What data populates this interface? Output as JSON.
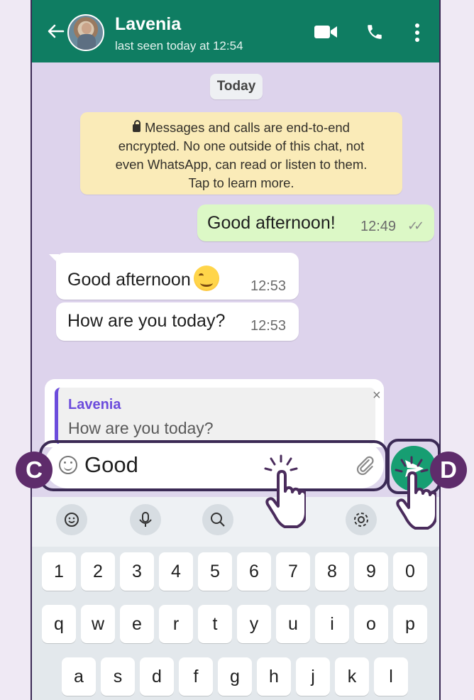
{
  "header": {
    "contact_name": "Lavenia",
    "last_seen": "last seen today at 12:54",
    "color": "#0f7d62"
  },
  "chat": {
    "date_chip": "Today",
    "encryption_notice": [
      "Messages and calls are end-to-end",
      "encrypted. No one outside of this chat, not",
      "even WhatsApp, can read or listen to them.",
      "Tap to learn more."
    ],
    "messages": [
      {
        "direction": "outgoing",
        "text": "Good afternoon!",
        "time": "12:49",
        "status": "read"
      },
      {
        "direction": "incoming",
        "text": "Good afternoon",
        "emoji": "smiling-face",
        "time": "12:53"
      },
      {
        "direction": "incoming",
        "text": "How are you today?",
        "time": "12:53"
      }
    ]
  },
  "reply": {
    "name": "Lavenia",
    "text": "How are you today?",
    "close": "×"
  },
  "composer": {
    "value": "Good",
    "send_color": "#179e72"
  },
  "markers": {
    "c": "C",
    "d": "D"
  },
  "keyboard": {
    "suggestion_icons": [
      "emoji-icon",
      "mic-icon",
      "search-icon",
      "settings-icon"
    ],
    "row1": [
      "1",
      "2",
      "3",
      "4",
      "5",
      "6",
      "7",
      "8",
      "9",
      "0"
    ],
    "row2": [
      "q",
      "w",
      "e",
      "r",
      "t",
      "y",
      "u",
      "i",
      "o",
      "p"
    ],
    "row3": [
      "a",
      "s",
      "d",
      "f",
      "g",
      "h",
      "j",
      "k",
      "l"
    ]
  }
}
